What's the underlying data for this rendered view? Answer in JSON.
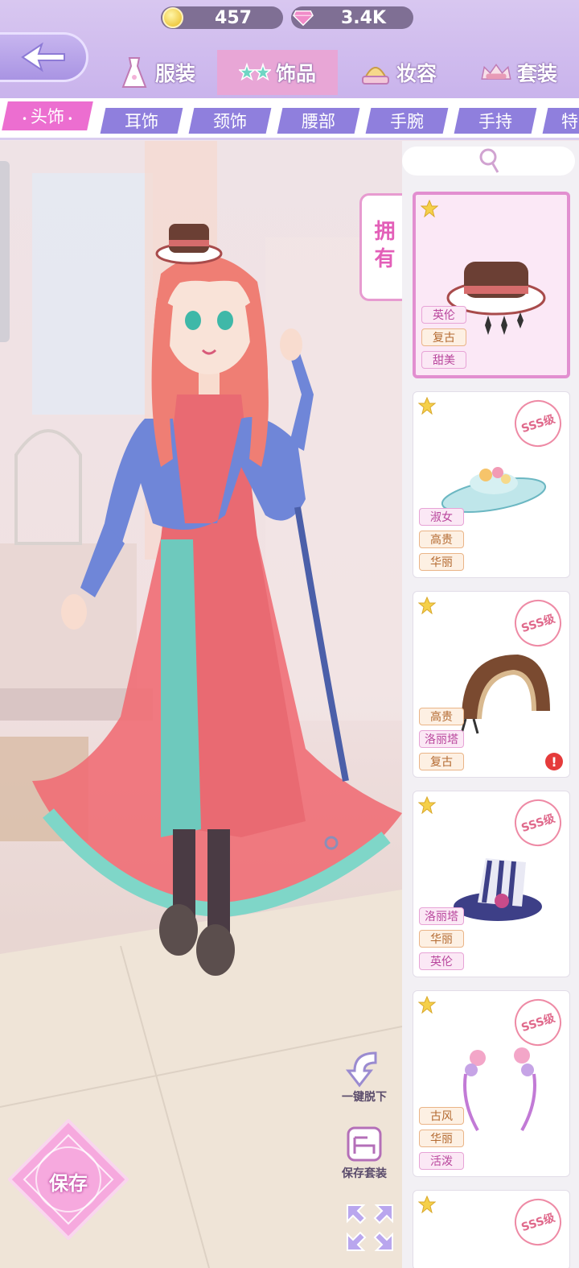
{
  "currency": {
    "coins": "457",
    "gems": "3.4K",
    "coin_icon": "gold-coin",
    "gem_icon": "pink-diamond"
  },
  "categories": [
    {
      "label": "服装",
      "icon": "dress-icon"
    },
    {
      "label": "饰品",
      "icon": "stars-glasses-icon",
      "active": true
    },
    {
      "label": "妆容",
      "icon": "makeup-icon"
    },
    {
      "label": "套装",
      "icon": "sale-crown-icon"
    }
  ],
  "subcategories": [
    {
      "label": "头饰",
      "active": true
    },
    {
      "label": "耳饰"
    },
    {
      "label": "颈饰"
    },
    {
      "label": "腰部"
    },
    {
      "label": "手腕"
    },
    {
      "label": "手持"
    },
    {
      "label": "特"
    }
  ],
  "owned_tab": "拥有",
  "grade_label": "SSS级",
  "items": [
    {
      "tags": [
        {
          "text": "英伦",
          "color": "pink"
        },
        {
          "text": "复古",
          "color": "orange"
        },
        {
          "text": "甜美",
          "color": "pink"
        }
      ],
      "selected": true,
      "graded": false,
      "warn": false
    },
    {
      "tags": [
        {
          "text": "淑女",
          "color": "pink"
        },
        {
          "text": "高贵",
          "color": "orange"
        },
        {
          "text": "华丽",
          "color": "orange"
        }
      ],
      "selected": false,
      "graded": true,
      "warn": false
    },
    {
      "tags": [
        {
          "text": "高贵",
          "color": "orange"
        },
        {
          "text": "洛丽塔",
          "color": "pink"
        },
        {
          "text": "复古",
          "color": "orange"
        }
      ],
      "selected": false,
      "graded": true,
      "warn": true
    },
    {
      "tags": [
        {
          "text": "洛丽塔",
          "color": "pink"
        },
        {
          "text": "华丽",
          "color": "orange"
        },
        {
          "text": "英伦",
          "color": "pink"
        }
      ],
      "selected": false,
      "graded": true,
      "warn": false
    },
    {
      "tags": [
        {
          "text": "古风",
          "color": "orange"
        },
        {
          "text": "华丽",
          "color": "orange"
        },
        {
          "text": "活泼",
          "color": "pink"
        }
      ],
      "selected": false,
      "graded": true,
      "warn": false
    },
    {
      "tags": [],
      "selected": false,
      "graded": true,
      "warn": false
    }
  ],
  "tools": {
    "undress_all": "一键脱下",
    "save_outfit": "保存套装"
  },
  "save_button": "保存",
  "colors": {
    "accent_pink": "#e28fd0",
    "tab_purple": "#8f7fdd",
    "active_subtab": "#ec6ed0"
  }
}
